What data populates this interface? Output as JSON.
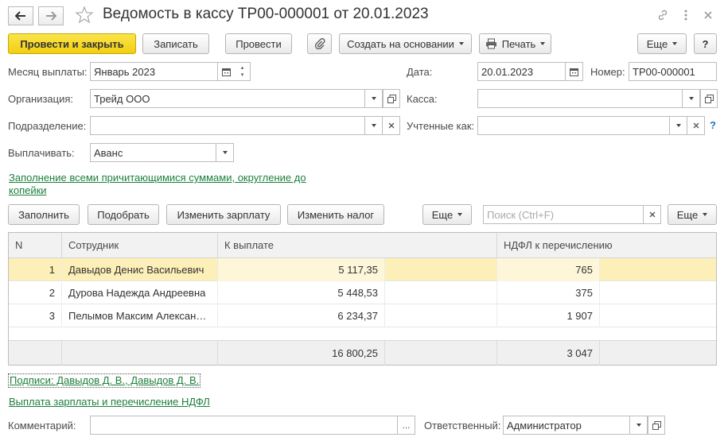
{
  "window": {
    "title": "Ведомость в кассу ТР00-000001 от 20.01.2023"
  },
  "toolbar": {
    "post_close": "Провести и закрыть",
    "save": "Записать",
    "post": "Провести",
    "create_based": "Создать на основании",
    "print": "Печать",
    "more": "Еще",
    "help": "?"
  },
  "form": {
    "month_label": "Месяц выплаты:",
    "month_value": "Январь 2023",
    "date_label": "Дата:",
    "date_value": "20.01.2023",
    "number_label": "Номер:",
    "number_value": "ТР00-000001",
    "org_label": "Организация:",
    "org_value": "Трейд ООО",
    "cash_label": "Касса:",
    "cash_value": "",
    "dept_label": "Подразделение:",
    "dept_value": "",
    "counted_label": "Учтенные как:",
    "counted_value": "",
    "counted_help": "?",
    "pay_label": "Выплачивать:",
    "pay_value": "Аванс",
    "fill_link_1": "Заполнение всеми причитающимися суммами, округление до",
    "fill_link_2": "копейки"
  },
  "table_toolbar": {
    "fill": "Заполнить",
    "pick": "Подобрать",
    "change_salary": "Изменить зарплату",
    "change_tax": "Изменить налог",
    "more1": "Еще",
    "search_placeholder": "Поиск (Ctrl+F)",
    "more2": "Еще"
  },
  "table": {
    "headers": [
      "N",
      "Сотрудник",
      "К выплате",
      "НДФЛ к перечислению"
    ],
    "rows": [
      {
        "n": "1",
        "employee": "Давыдов Денис Васильевич",
        "amount": "5 117,35",
        "tax": "765"
      },
      {
        "n": "2",
        "employee": "Дурова Надежда Андреевна",
        "amount": "5 448,53",
        "tax": "375"
      },
      {
        "n": "3",
        "employee": "Пелымов Максим Алексан…",
        "amount": "6 234,37",
        "tax": "1 907"
      }
    ],
    "total_amount": "16 800,25",
    "total_tax": "3 047"
  },
  "footer": {
    "signatures_link": "Подписи: Давыдов Д. В., Давыдов Д. В.",
    "payment_link": "Выплата зарплаты и перечисление НДФЛ",
    "comment_label": "Комментарий:",
    "comment_value": "",
    "comment_btn": "...",
    "responsible_label": "Ответственный:",
    "responsible_value": "Администратор"
  }
}
